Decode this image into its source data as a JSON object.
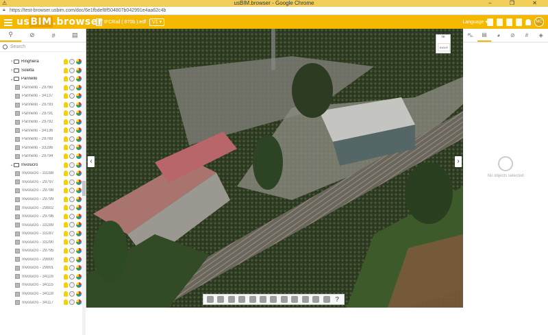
{
  "browser": {
    "title": "usBIM.browser - Google Chrome",
    "url": "https://test-browser.usbim.com/doc/6e1fbdef8f504807b042991e4aa62c4b",
    "controls": "– ❐ ✕"
  },
  "app": {
    "logo_main": "us",
    "logo_bim": "BIM",
    "logo_suffix": ".browser",
    "file_name": "IFCRail ( 870b ).edf",
    "version": "V1",
    "language_label": "Language",
    "avatar_initials": "MC",
    "accent_color": "#f5b800"
  },
  "left_panel": {
    "tabs": [
      "tree-icon",
      "link-icon",
      "hash-icon",
      "list-icon"
    ],
    "tab_glyphs": [
      "⚲",
      "⊘",
      "#",
      "▤"
    ],
    "search_placeholder": "Search",
    "tree": [
      {
        "type": "folder",
        "label": "Ringhiera",
        "expanded": false
      },
      {
        "type": "folder",
        "label": "Soletta",
        "expanded": false
      },
      {
        "type": "folder",
        "label": "Pannello",
        "expanded": true
      },
      {
        "type": "item",
        "label": "Pannello - 29760"
      },
      {
        "type": "item",
        "label": "Pannello - 34137"
      },
      {
        "type": "item",
        "label": "Pannello - 29793"
      },
      {
        "type": "item",
        "label": "Pannello - 29791"
      },
      {
        "type": "item",
        "label": "Pannello - 29792"
      },
      {
        "type": "item",
        "label": "Pannello - 34136"
      },
      {
        "type": "item",
        "label": "Pannello - 29769"
      },
      {
        "type": "item",
        "label": "Pannello - 33286"
      },
      {
        "type": "item",
        "label": "Pannello - 29794"
      },
      {
        "type": "folder",
        "label": "Involucro",
        "expanded": true
      },
      {
        "type": "item",
        "label": "Involucro - 33288"
      },
      {
        "type": "item",
        "label": "Involucro - 29797"
      },
      {
        "type": "item",
        "label": "Involucro - 29798"
      },
      {
        "type": "item",
        "label": "Involucro - 29799"
      },
      {
        "type": "item",
        "label": "Involucro - 29802"
      },
      {
        "type": "item",
        "label": "Involucro - 29796"
      },
      {
        "type": "item",
        "label": "Involucro - 33289"
      },
      {
        "type": "item",
        "label": "Involucro - 33287"
      },
      {
        "type": "item",
        "label": "Involucro - 33290"
      },
      {
        "type": "item",
        "label": "Involucro - 29795"
      },
      {
        "type": "item",
        "label": "Involucro - 29800"
      },
      {
        "type": "item",
        "label": "Involucro - 29801"
      },
      {
        "type": "item",
        "label": "Involucro - 34116"
      },
      {
        "type": "item",
        "label": "Involucro - 34115"
      },
      {
        "type": "item",
        "label": "Involucro - 34118"
      },
      {
        "type": "item",
        "label": "Involucro - 34117"
      }
    ]
  },
  "viewer": {
    "viewcube_top": "TE",
    "viewcube_face": "RIGHT",
    "nav_left": "‹",
    "nav_right": "›",
    "toolbar_icons": [
      "camera-icon",
      "cube-icon",
      "section-icon",
      "layers-icon",
      "explode-icon",
      "measure-icon",
      "pencil-icon",
      "edit-icon",
      "target-icon",
      "copy-icon",
      "settings-icon",
      "fullscreen-icon",
      "help-icon"
    ],
    "help_glyph": "?"
  },
  "right_panel": {
    "tabs": [
      "train-icon",
      "document-icon",
      "palette-icon",
      "link-icon",
      "hash-icon",
      "tag-icon"
    ],
    "tab_glyphs": [
      "⛍",
      "▤",
      "◕",
      "⊘",
      "#",
      "◈"
    ],
    "empty_message": "No objects selected"
  }
}
